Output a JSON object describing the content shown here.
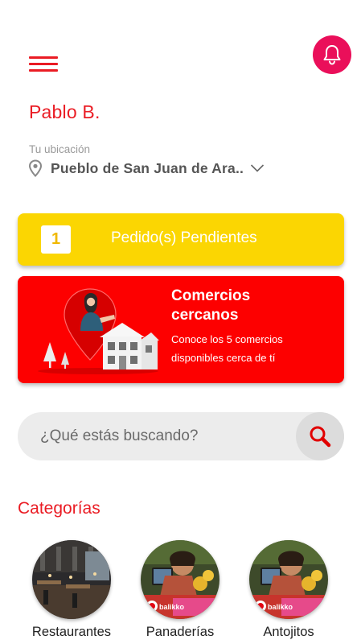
{
  "header": {
    "menu_icon": "hamburger-menu-icon",
    "notification_icon": "bell-icon"
  },
  "user": {
    "name": "Pablo B."
  },
  "location": {
    "label": "Tu ubicación",
    "value": "Pueblo de San Juan de Ara..",
    "icon": "location-pin-icon"
  },
  "pending_orders": {
    "count": "1",
    "label": "Pedido(s) Pendientes"
  },
  "nearby": {
    "title": "Comercios cercanos",
    "description": "Conoce los 5 comercios disponibles cerca de tí"
  },
  "search": {
    "placeholder": "¿Qué estás buscando?",
    "icon": "search-icon"
  },
  "categories": {
    "title": "Categorías",
    "items": [
      {
        "label": "Restaurantes"
      },
      {
        "label": "Panaderías"
      },
      {
        "label": "Antojitos"
      }
    ],
    "promo_brand": "balikko"
  },
  "colors": {
    "accent_red": "#ea1c24",
    "notification_pink": "#ea0f5a",
    "pending_yellow": "#fbd602",
    "nearby_red": "#fd0000",
    "search_bg": "#ececec"
  }
}
